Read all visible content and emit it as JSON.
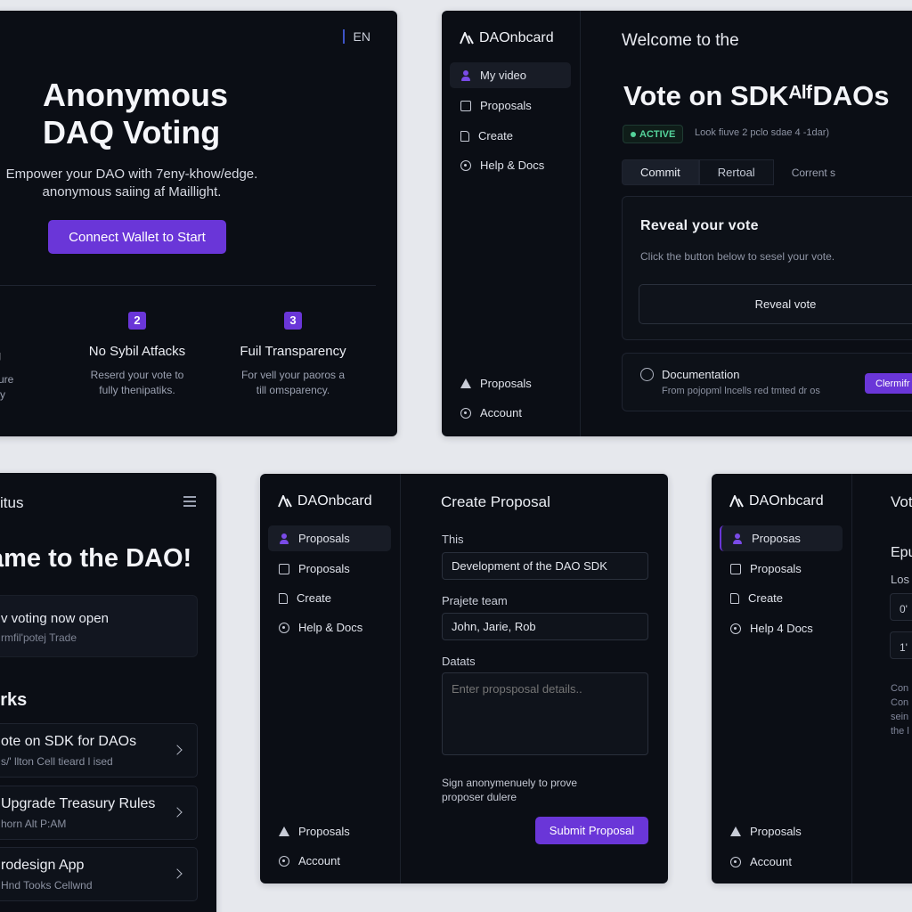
{
  "landing": {
    "lang": "EN",
    "title_line1": "Anonymous",
    "title_line2": "DAQ Voting",
    "subtitle_line1": "Empower your DAO with 7eny-khow/edge.",
    "subtitle_line2": "anonymous saiing af Maillight.",
    "cta": "Connect Wallet to Start",
    "features": [
      {
        "num": "",
        "title": "g",
        "desc1": "pncure",
        "desc2": "ally"
      },
      {
        "num": "2",
        "title": "No Sybil Atfacks",
        "desc1": "Reserd your vote to",
        "desc2": "fully thenipatiks."
      },
      {
        "num": "3",
        "title": "Fuil Transparency",
        "desc1": "For vell your paoros a",
        "desc2": "till omsparency."
      }
    ]
  },
  "vote_panel": {
    "brand": "DAOnbcard",
    "nav": {
      "item1": "My video",
      "item2": "Proposals",
      "item3": "Create",
      "item4": "Help & Docs",
      "bottom1": "Proposals",
      "bottom2": "Account"
    },
    "welcome": "Welcome to the",
    "title": "Vote on SDKᴬˡᶠDAOs",
    "badge": "ACTIVE",
    "meta": "Look fiuve 2 pclo sdae 4 -1dar)",
    "tabs": [
      "Commit",
      "Rertoal",
      "Corrent s"
    ],
    "card_title": "Reveal your vote",
    "card_desc": "Click the button below to sesel your vote.",
    "card_button": "Reveal vote",
    "doc_title": "Documentation",
    "doc_desc": "From pojopml lncells red tmted dr os",
    "doc_button": "Clermifr"
  },
  "dao_home": {
    "top_title": "itus",
    "headline": "ame to the DAO!",
    "notice_title": "v voting now open",
    "notice_desc": "rmfil'potej Trade",
    "section": "orks",
    "proposals": [
      {
        "title": "ote on SDK for DAOs",
        "desc": "s/' llton Cell tieard l ised"
      },
      {
        "title": "Upgrade Treasury Rules",
        "desc": "horn Alt P:AM"
      },
      {
        "title": "rodesign App",
        "desc": "Hnd Tooks Cellwnd"
      }
    ]
  },
  "create_panel": {
    "brand": "DAOnbcard",
    "nav": {
      "item1": "Proposals",
      "item2": "Proposals",
      "item3": "Create",
      "item4": "Help & Docs",
      "bottom1": "Proposals",
      "bottom2": "Account"
    },
    "title": "Create Proposal",
    "label_title": "This",
    "value_title": "Development of the DAO SDK",
    "label_team": "Prajete team",
    "value_team": "John, Jarie, Rob",
    "label_details": "Datats",
    "placeholder_details": "Enter propsposal details..",
    "sign_line1": "Sign anonymenuely to prove",
    "sign_line2": "proposer dulere",
    "submit": "Submit Proposal"
  },
  "vote_panel_2": {
    "brand": "DAOnbcard",
    "nav": {
      "item1": "Proposas",
      "item2": "Proposals",
      "item3": "Create",
      "item4": "Help 4 Docs",
      "bottom1": "Proposals",
      "bottom2": "Account"
    },
    "title": "Vot",
    "section": "Epu",
    "label": "Los",
    "box1": "0'",
    "box2": "1'",
    "para_lines": [
      "Con",
      "Con",
      "sein",
      "the l"
    ]
  },
  "colors": {
    "accent": "#6a36d8",
    "panel_bg": "#0b0e15",
    "page_bg": "#e6e8ed",
    "active_green": "#54d39a"
  },
  "icons": {
    "brand": "logo-icon",
    "user": "user-icon",
    "proposals": "box-icon",
    "create": "document-icon",
    "help": "help-circle-icon",
    "account": "account-icon"
  }
}
